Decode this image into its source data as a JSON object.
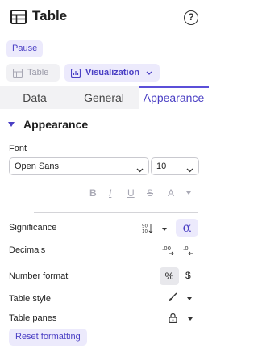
{
  "header": {
    "title": "Table",
    "help_label": "?",
    "table_icon": "table-icon",
    "help_icon": "help-circle-icon"
  },
  "pause": {
    "label": "Pause"
  },
  "view_chips": {
    "table_label": "Table",
    "visualization_label": "Visualization"
  },
  "tabs": [
    {
      "label": "Data",
      "active": false
    },
    {
      "label": "General",
      "active": false
    },
    {
      "label": "Appearance",
      "active": true
    }
  ],
  "section": {
    "title": "Appearance",
    "expanded": true
  },
  "font": {
    "label": "Font",
    "family": "Open Sans",
    "size": "10"
  },
  "text_format": {
    "bold": "B",
    "italic": "I",
    "underline": "U",
    "strikethrough": "S",
    "color": "A"
  },
  "rows": {
    "significance": "Significance",
    "significance_alpha": "α",
    "decimals": "Decimals",
    "number_format": "Number format",
    "number_format_percent": "%",
    "number_format_dollar": "$",
    "table_style": "Table style",
    "table_panes": "Table panes"
  },
  "reset": {
    "label": "Reset formatting"
  },
  "colors": {
    "accent": "#4a3fc4",
    "accent_bg": "#eceafc",
    "tab_inactive_bg": "#f2f2f4"
  }
}
